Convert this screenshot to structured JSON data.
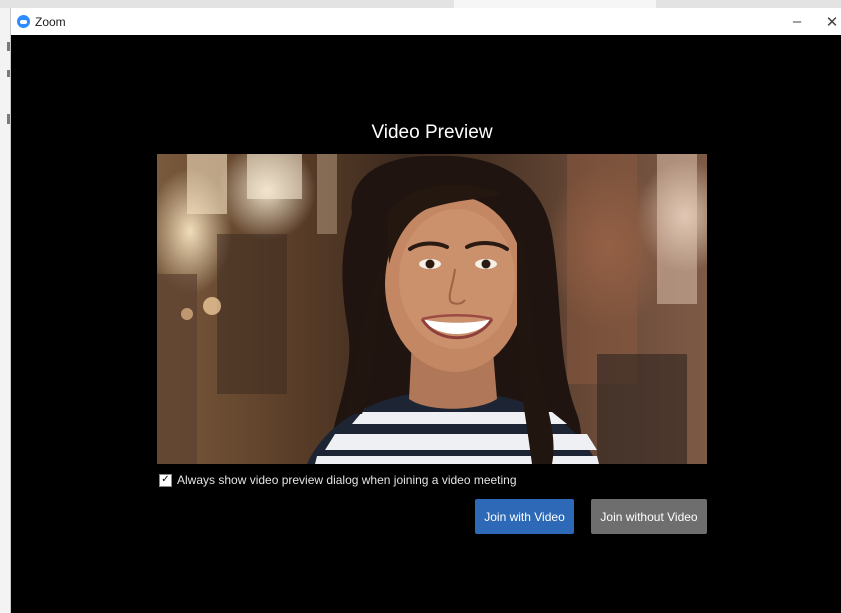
{
  "window": {
    "title": "Zoom",
    "minimize_glyph": "–",
    "close_glyph": "✕"
  },
  "preview": {
    "title": "Video Preview"
  },
  "options": {
    "always_show_label": "Always show video preview dialog when joining a video meeting",
    "always_show_checked": true
  },
  "actions": {
    "join_with_video": "Join with Video",
    "join_without_video": "Join without Video"
  },
  "colors": {
    "accent": "#2d69b6",
    "secondary_button": "#6e6e6e",
    "background": "#000000"
  },
  "icons": {
    "app": "zoom-logo-icon",
    "minimize": "minimize-icon",
    "close": "close-icon",
    "checkbox": "checkmark-icon"
  }
}
